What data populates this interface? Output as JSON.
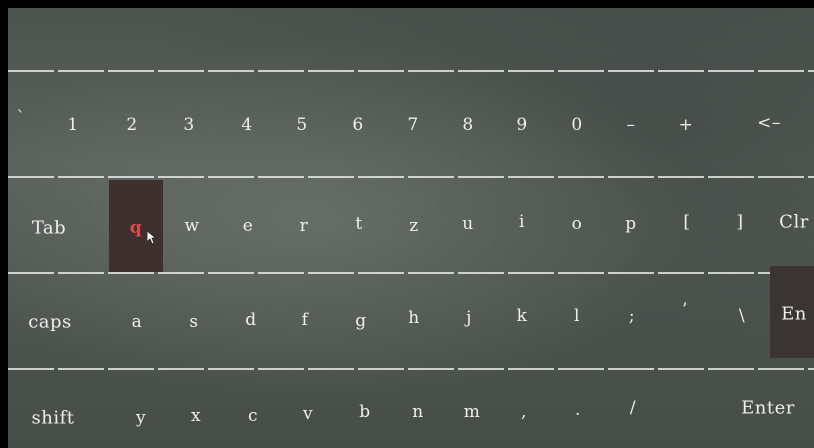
{
  "keyboard": {
    "row_numbers": [
      "`",
      "1",
      "2",
      "3",
      "4",
      "5",
      "6",
      "7",
      "8",
      "9",
      "0",
      "–",
      "+",
      "<–"
    ],
    "row_top": [
      "Tab",
      "q",
      "w",
      "e",
      "r",
      "t",
      "z",
      "u",
      "i",
      "o",
      "p",
      "[",
      "]",
      "Clr"
    ],
    "row_home": [
      "caps",
      "a",
      "s",
      "d",
      "f",
      "g",
      "h",
      "j",
      "k",
      "l",
      ";",
      "’",
      "\\",
      "En"
    ],
    "row_bottom": [
      "shift",
      "y",
      "x",
      "c",
      "v",
      "b",
      "n",
      "m",
      ",",
      ".",
      "/",
      "Enter"
    ],
    "active_key": "q",
    "colors": {
      "background": "#545a55",
      "key_text": "#eef0ec",
      "active_key_text": "#e0464b",
      "active_key_bg": "#3e302d"
    }
  }
}
